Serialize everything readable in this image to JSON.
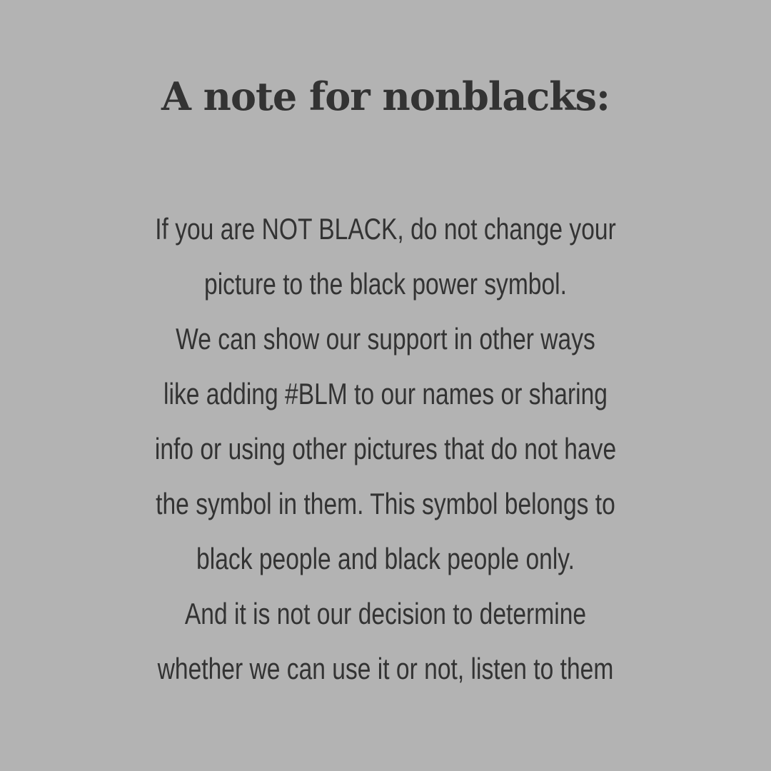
{
  "background_color": "#b3b3b3",
  "text_color": "#333333",
  "title": "A note for nonblacks:",
  "lines": [
    "If you are NOT BLACK, do not change your",
    "picture to the black power symbol.",
    "We can show our support in other ways",
    "like adding #BLM to our names or sharing",
    "info or using other pictures that do not have",
    "the symbol in them. This symbol belongs to",
    "black people and black people only.",
    "And it is not our decision to determine",
    "whether we can use it or not, listen to them"
  ]
}
